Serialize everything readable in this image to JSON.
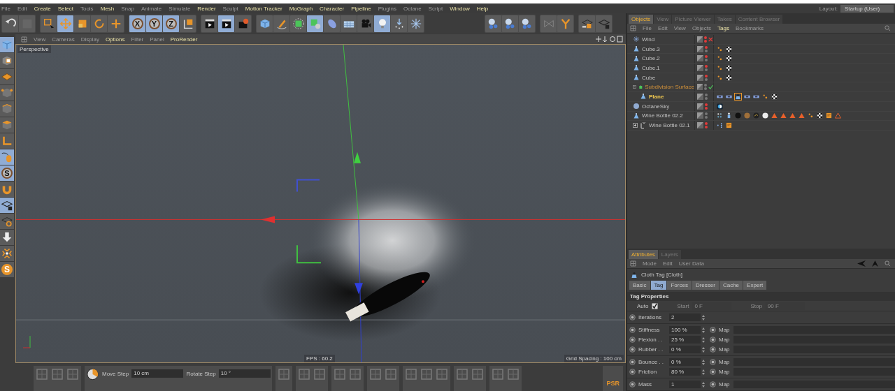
{
  "menu": [
    {
      "label": "File",
      "highlighted": false
    },
    {
      "label": "Edit",
      "highlighted": false
    },
    {
      "label": "Create",
      "highlighted": true
    },
    {
      "label": "Select",
      "highlighted": true
    },
    {
      "label": "Tools",
      "highlighted": false
    },
    {
      "label": "Mesh",
      "highlighted": true
    },
    {
      "label": "Snap",
      "highlighted": false
    },
    {
      "label": "Animate",
      "highlighted": false
    },
    {
      "label": "Simulate",
      "highlighted": false
    },
    {
      "label": "Render",
      "highlighted": true
    },
    {
      "label": "Sculpt",
      "highlighted": false
    },
    {
      "label": "Motion Tracker",
      "highlighted": true
    },
    {
      "label": "MoGraph",
      "highlighted": true
    },
    {
      "label": "Character",
      "highlighted": true
    },
    {
      "label": "Pipeline",
      "highlighted": true
    },
    {
      "label": "Plugins",
      "highlighted": false
    },
    {
      "label": "Octane",
      "highlighted": false
    },
    {
      "label": "Script",
      "highlighted": false
    },
    {
      "label": "Window",
      "highlighted": true
    },
    {
      "label": "Help",
      "highlighted": true
    }
  ],
  "layout": {
    "label": "Layout:",
    "value": "Startup (User)"
  },
  "toolbar": [
    [
      {
        "kind": "undo",
        "selected": false
      },
      {
        "kind": "redo",
        "selected": false
      }
    ],
    [
      {
        "kind": "select-rect",
        "selected": false
      },
      {
        "kind": "move",
        "selected": true
      },
      {
        "kind": "scale",
        "selected": false
      },
      {
        "kind": "rotate",
        "selected": false
      },
      {
        "kind": "plus",
        "selected": false
      }
    ],
    [
      {
        "kind": "axis-letter",
        "label": "X",
        "selected": true
      },
      {
        "kind": "axis-letter",
        "label": "Y",
        "selected": true
      },
      {
        "kind": "axis-letter",
        "label": "Z",
        "selected": true
      },
      {
        "kind": "axis-cube",
        "selected": false
      }
    ],
    [
      {
        "kind": "clapper",
        "selected": false
      },
      {
        "kind": "clapper",
        "selected": true
      },
      {
        "kind": "clapper-gear",
        "selected": false
      }
    ],
    [
      {
        "kind": "cube",
        "selected": false
      },
      {
        "kind": "pen",
        "selected": false
      },
      {
        "kind": "generator-cube",
        "selected": false
      },
      {
        "kind": "cube-cluster",
        "selected": true
      },
      {
        "kind": "capsule",
        "selected": false
      },
      {
        "kind": "grid-plane",
        "selected": false
      },
      {
        "kind": "camera",
        "selected": false
      },
      {
        "kind": "bulb",
        "selected": true
      },
      {
        "kind": "dots-arrow",
        "selected": false
      },
      {
        "kind": "snowflake",
        "selected": false
      }
    ],
    [
      {
        "kind": "sphere-group",
        "selected": false
      },
      {
        "kind": "sphere-group",
        "selected": false
      },
      {
        "kind": "sphere-group",
        "selected": false
      }
    ],
    [
      {
        "kind": "mirror",
        "selected": false
      },
      {
        "kind": "y-shape",
        "selected": false
      }
    ],
    [
      {
        "kind": "grid-cube",
        "selected": false
      },
      {
        "kind": "grid-lock",
        "selected": false
      }
    ]
  ],
  "tools": [
    {
      "kind": "cube",
      "selected": true
    },
    {
      "kind": "checker-cube",
      "selected": false
    },
    {
      "kind": "flat-grid",
      "selected": false
    },
    {
      "kind": "cube-points",
      "selected": false
    },
    {
      "kind": "cube-edges",
      "selected": false
    },
    {
      "kind": "cube-face",
      "selected": false
    },
    {
      "kind": "l-shape",
      "selected": false
    },
    {
      "kind": "mouse",
      "selected": true
    },
    {
      "kind": "letter-circle",
      "label": "S",
      "selected": true
    },
    {
      "kind": "magnet",
      "selected": false
    },
    {
      "kind": "grid-lock",
      "selected": true
    },
    {
      "kind": "grid-ring",
      "selected": false
    },
    {
      "kind": "down-arrow",
      "selected": false
    },
    {
      "kind": "x-arrows",
      "selected": false
    },
    {
      "kind": "letter-badge",
      "label": "S",
      "selected": false
    }
  ],
  "viewport": {
    "menu": [
      {
        "label": "View",
        "highlighted": false
      },
      {
        "label": "Cameras",
        "highlighted": false
      },
      {
        "label": "Display",
        "highlighted": false
      },
      {
        "label": "Options",
        "highlighted": true
      },
      {
        "label": "Filter",
        "highlighted": false
      },
      {
        "label": "Panel",
        "highlighted": false
      },
      {
        "label": "ProRender",
        "highlighted": true
      }
    ],
    "camera": "Perspective",
    "fps": "FPS : 60.2",
    "grid_spacing": "Grid Spacing : 100 cm"
  },
  "bottom_bar": {
    "fields": [
      {
        "label": "Move Step",
        "value": "10 cm"
      },
      {
        "label": "Rotate Step",
        "value": "10 °"
      }
    ],
    "psr": "PSR"
  },
  "object_manager": {
    "tabs": [
      {
        "label": "Objects",
        "selected": true
      },
      {
        "label": "View",
        "selected": false
      },
      {
        "label": "Picture Viewer",
        "selected": false
      },
      {
        "label": "Takes",
        "selected": false
      },
      {
        "label": "Content Browser",
        "selected": false
      }
    ],
    "menu": [
      {
        "label": "File",
        "highlighted": false
      },
      {
        "label": "Edit",
        "highlighted": false
      },
      {
        "label": "View",
        "highlighted": false
      },
      {
        "label": "Objects",
        "highlighted": false
      },
      {
        "label": "Tags",
        "highlighted": true
      },
      {
        "label": "Bookmarks",
        "highlighted": false
      }
    ],
    "objects": [
      {
        "name": "Wind",
        "kind": "wind",
        "highlighted": false,
        "selected": false,
        "hidden_in_editor": true,
        "hidden_in_render": true,
        "enabled": false
      },
      {
        "name": "Cube.3",
        "kind": "polygon",
        "highlighted": false,
        "selected": false,
        "hidden_in_editor": true,
        "hidden_in_render": false,
        "tags": [
          {
            "kind": "phong",
            "selected": false
          },
          {
            "kind": "texture",
            "selected": false
          }
        ]
      },
      {
        "name": "Cube.2",
        "kind": "polygon",
        "highlighted": false,
        "selected": false,
        "hidden_in_editor": true,
        "hidden_in_render": false,
        "tags": [
          {
            "kind": "phong",
            "selected": false
          },
          {
            "kind": "texture",
            "selected": false
          }
        ]
      },
      {
        "name": "Cube.1",
        "kind": "polygon",
        "highlighted": false,
        "selected": false,
        "hidden_in_editor": true,
        "hidden_in_render": false,
        "tags": [
          {
            "kind": "phong",
            "selected": false
          },
          {
            "kind": "texture",
            "selected": false
          }
        ]
      },
      {
        "name": "Cube",
        "kind": "polygon",
        "highlighted": false,
        "selected": false,
        "hidden_in_editor": true,
        "hidden_in_render": false,
        "tags": [
          {
            "kind": "phong",
            "selected": false
          },
          {
            "kind": "texture",
            "selected": false
          }
        ]
      },
      {
        "name": "Subdivision Surface",
        "kind": "subdivision",
        "highlighted": true,
        "selected": false,
        "hidden_in_editor": false,
        "hidden_in_render": false,
        "enabled": true,
        "expanded": true,
        "children": [
          {
            "name": "Plane",
            "kind": "polygon",
            "highlighted": false,
            "selected": true,
            "hidden_in_editor": false,
            "hidden_in_render": false,
            "tags": [
              {
                "kind": "constraint",
                "selected": false
              },
              {
                "kind": "constraint",
                "selected": false
              },
              {
                "kind": "cloth",
                "selected": true
              },
              {
                "kind": "constraint",
                "selected": false
              },
              {
                "kind": "constraint",
                "selected": false
              },
              {
                "kind": "phong",
                "selected": false
              },
              {
                "kind": "texture",
                "selected": false
              }
            ]
          }
        ]
      },
      {
        "name": "OctaneSky",
        "kind": "sky",
        "highlighted": false,
        "selected": false,
        "hidden_in_editor": true,
        "hidden_in_render": true,
        "tags": [
          {
            "kind": "sky-tag",
            "selected": false
          }
        ]
      },
      {
        "name": "Wine Bottle 02.2",
        "kind": "polygon",
        "highlighted": false,
        "selected": false,
        "hidden_in_editor": false,
        "hidden_in_render": false,
        "tags": [
          {
            "kind": "dots",
            "selected": false
          },
          {
            "kind": "figure",
            "selected": false
          },
          {
            "kind": "material-black",
            "selected": false
          },
          {
            "kind": "material-brown",
            "selected": false
          },
          {
            "kind": "material-gold",
            "selected": false
          },
          {
            "kind": "material-white",
            "selected": false
          },
          {
            "kind": "triangle",
            "selected": false
          },
          {
            "kind": "triangle",
            "selected": false
          },
          {
            "kind": "triangle",
            "selected": false
          },
          {
            "kind": "triangle",
            "selected": false
          },
          {
            "kind": "phong",
            "selected": false
          },
          {
            "kind": "texture",
            "selected": false
          },
          {
            "kind": "note",
            "selected": false
          },
          {
            "kind": "warning",
            "selected": false
          }
        ]
      },
      {
        "name": "Wine Bottle 02.1",
        "kind": "null",
        "highlighted": false,
        "selected": false,
        "hidden_in_editor": true,
        "hidden_in_render": true,
        "expanded": false,
        "tags": [
          {
            "kind": "hierarchy",
            "selected": false
          },
          {
            "kind": "note",
            "selected": false
          }
        ]
      }
    ]
  },
  "attributes": {
    "tabs": [
      {
        "label": "Attributes",
        "selected": true
      },
      {
        "label": "Layers",
        "selected": false
      }
    ],
    "menu": [
      {
        "label": "Mode",
        "highlighted": false
      },
      {
        "label": "Edit",
        "highlighted": false
      },
      {
        "label": "User Data",
        "highlighted": false
      }
    ],
    "title": "Cloth Tag [Cloth]",
    "pages": [
      {
        "label": "Basic",
        "selected": false
      },
      {
        "label": "Tag",
        "selected": true
      },
      {
        "label": "Forces",
        "selected": false
      },
      {
        "label": "Dresser",
        "selected": false
      },
      {
        "label": "Cache",
        "selected": false
      },
      {
        "label": "Expert",
        "selected": false
      }
    ],
    "section": "Tag Properties",
    "auto": {
      "label": "Auto",
      "checked": true
    },
    "start": {
      "label": "Start",
      "value": "0 F",
      "disabled": true
    },
    "stop": {
      "label": "Stop",
      "value": "90 F",
      "disabled": true
    },
    "groups": [
      [
        {
          "label": "Iterations",
          "value": "2",
          "map": false
        }
      ],
      [
        {
          "label": "Stiffness",
          "value": "100 %",
          "map": true,
          "map_label": "Map"
        },
        {
          "label": "Flexion . .",
          "value": "25 %",
          "map": true,
          "map_label": "Map"
        },
        {
          "label": "Rubber . .",
          "value": "0 %",
          "map": true,
          "map_label": "Map"
        }
      ],
      [
        {
          "label": "Bounce . .",
          "value": "0 %",
          "map": true,
          "map_label": "Map"
        },
        {
          "label": "Friction",
          "value": "80 %",
          "map": true,
          "map_label": "Map"
        }
      ],
      [
        {
          "label": "Mass",
          "value": "1",
          "map": true,
          "map_label": "Map"
        }
      ]
    ]
  }
}
